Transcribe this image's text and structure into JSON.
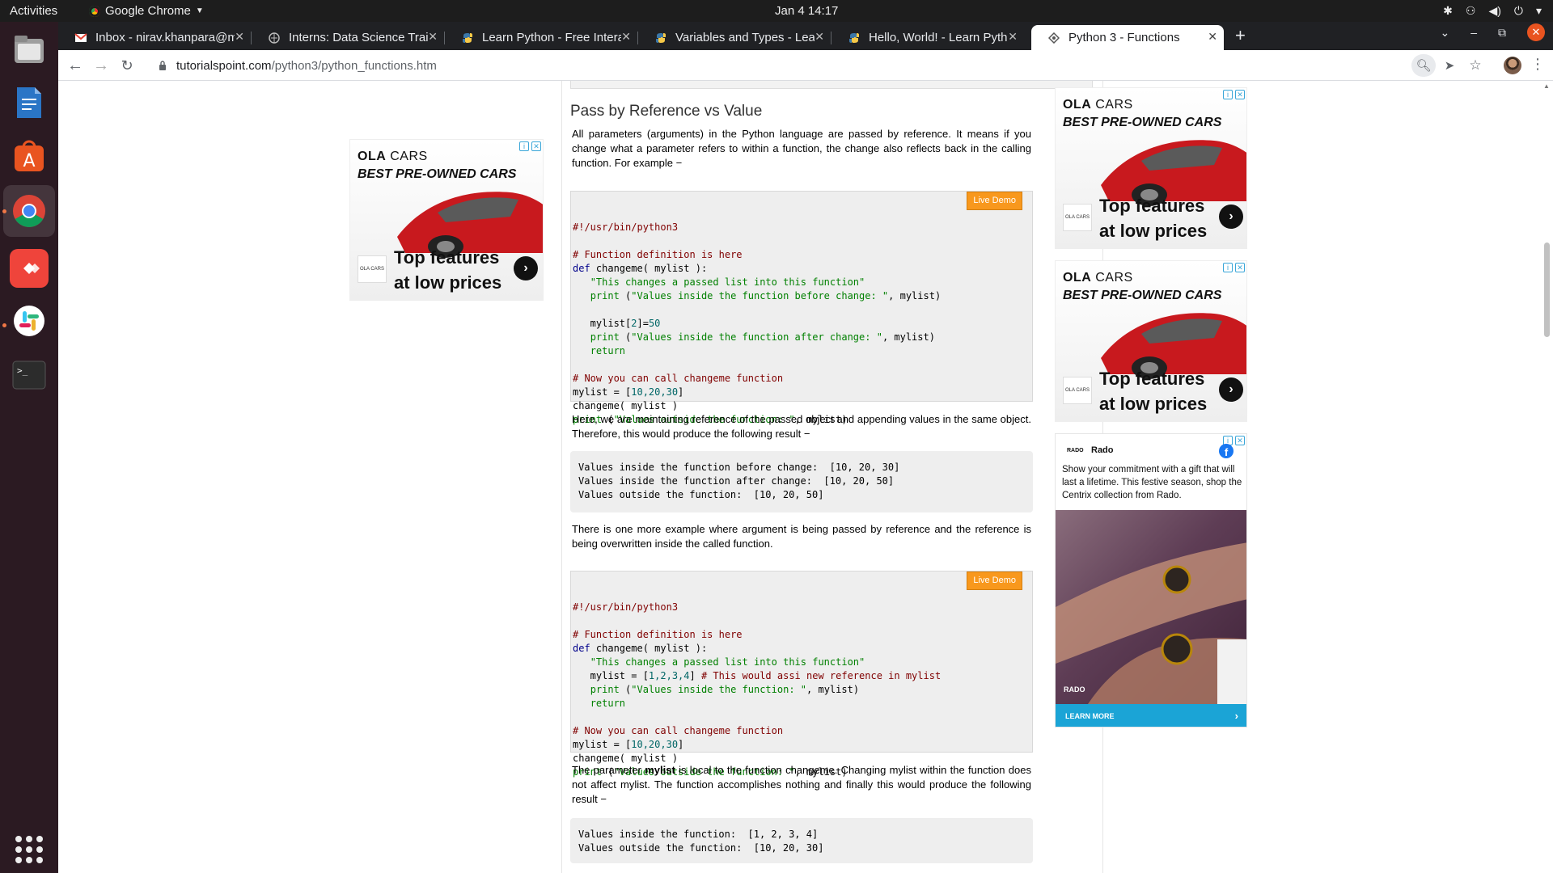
{
  "system": {
    "activities": "Activities",
    "app_name": "Google Chrome",
    "clock": "Jan 4  14:17"
  },
  "dock": {
    "items": [
      "Files",
      "LibreOffice Writer",
      "Ubuntu Software",
      "Google Chrome",
      "AnyDesk",
      "Slack",
      "Terminal",
      "Show Applications"
    ]
  },
  "tabs": [
    {
      "label": "Inbox - nirav.khanpara@m",
      "icon": "gmail-icon"
    },
    {
      "label": "Interns: Data Science Trai",
      "icon": "globe-icon"
    },
    {
      "label": "Learn Python - Free Intera",
      "icon": "python-icon"
    },
    {
      "label": "Variables and Types - Lear",
      "icon": "python-icon"
    },
    {
      "label": "Hello, World! - Learn Pyth",
      "icon": "python-icon"
    },
    {
      "label": "Python 3 - Functions",
      "icon": "tutorialspoint-icon",
      "active": true
    }
  ],
  "toolbar": {
    "url_host": "tutorialspoint.com",
    "url_path": "/python3/python_functions.htm"
  },
  "article": {
    "heading": "Pass by Reference vs Value",
    "para1": "All parameters (arguments) in the Python language are passed by reference. It means if you change what a parameter refers to within a function, the change also reflects back in the calling function. For example −",
    "live_demo": "Live Demo",
    "para2": "Here, we are maintaining reference of the passed object and appending values in the same object. Therefore, this would produce the following result −",
    "output1": "Values inside the function before change:  [10, 20, 30]\nValues inside the function after change:  [10, 20, 50]\nValues outside the function:  [10, 20, 50]",
    "para3": "There is one more example where argument is being passed by reference and the reference is being overwritten inside the called function.",
    "para4_pre": "The parameter ",
    "para4_bold": "mylist",
    "para4_post": " is local to the function changeme. Changing mylist within the function does not affect mylist. The function accomplishes nothing and finally this would produce the following result −",
    "output2": "Values inside the function:  [1, 2, 3, 4]\nValues outside the function:  [10, 20, 30]",
    "code1": [
      {
        "t": "cm",
        "v": "#!/usr/bin/python3"
      },
      {
        "t": "",
        "v": ""
      },
      {
        "t": "cm",
        "v": "# Function definition is here"
      },
      {
        "t": "def",
        "v": "changeme( mylist ):"
      },
      {
        "t": "str",
        "v": "\"This changes a passed list into this function\""
      },
      {
        "t": "print",
        "v": "(\"Values inside the function before change: \", mylist)"
      },
      {
        "t": "",
        "v": ""
      },
      {
        "t": "plain",
        "v": "   mylist[2]=50"
      },
      {
        "t": "print",
        "v": "(\"Values inside the function after change: \", mylist)"
      },
      {
        "t": "ret",
        "v": "return"
      },
      {
        "t": "",
        "v": ""
      },
      {
        "t": "cm",
        "v": "# Now you can call changeme function"
      },
      {
        "t": "plain",
        "v": "mylist = [10,20,30]"
      },
      {
        "t": "plain",
        "v": "changeme( mylist )"
      },
      {
        "t": "print0",
        "v": "(\"Values outside the function: \", mylist)"
      }
    ],
    "code2": [
      {
        "t": "cm",
        "v": "#!/usr/bin/python3"
      },
      {
        "t": "",
        "v": ""
      },
      {
        "t": "cm",
        "v": "# Function definition is here"
      },
      {
        "t": "def",
        "v": "changeme( mylist ):"
      },
      {
        "t": "str",
        "v": "\"This changes a passed list into this function\""
      },
      {
        "t": "assign",
        "v": "mylist = [1,2,3,4]",
        "c": "# This would assi new reference in mylist"
      },
      {
        "t": "print",
        "v": "(\"Values inside the function: \", mylist)"
      },
      {
        "t": "ret",
        "v": "return"
      },
      {
        "t": "",
        "v": ""
      },
      {
        "t": "cm",
        "v": "# Now you can call changeme function"
      },
      {
        "t": "plain",
        "v": "mylist = [10,20,30]"
      },
      {
        "t": "plain",
        "v": "changeme( mylist )"
      },
      {
        "t": "print0",
        "v": "(\"Values outside the function: \", mylist)"
      }
    ]
  },
  "ads": {
    "ola": {
      "brand_bold": "OLA",
      "brand_rest": " CARS",
      "tagline": "BEST PRE-OWNED CARS",
      "mini_logo": "OLA CARS",
      "headline1": "Top features",
      "headline2": "at low prices"
    },
    "rado": {
      "logo": "RADO",
      "name": "Rado",
      "text": "Show your commitment with a gift that will last a lifetime. This festive season, shop the Centrix collection from Rado.",
      "cta": "LEARN MORE"
    }
  }
}
